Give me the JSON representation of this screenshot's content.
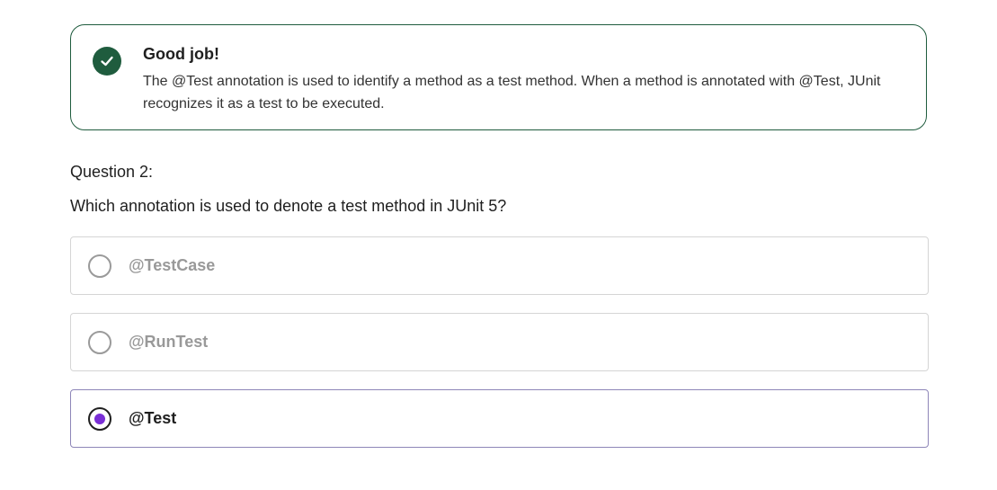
{
  "feedback": {
    "icon": "checkmark-icon",
    "status_color": "#1f5c3e",
    "title": "Good job!",
    "message": "The @Test annotation is used to identify a method as a test method. When a method is annotated with @Test, JUnit recognizes it as a test to be executed."
  },
  "question": {
    "number_label": "Question 2:",
    "text": "Which annotation is used to denote a test method in JUnit 5?",
    "accent_color": "#7a2fd6",
    "options": [
      {
        "label": "@TestCase",
        "selected": false
      },
      {
        "label": "@RunTest",
        "selected": false
      },
      {
        "label": "@Test",
        "selected": true
      }
    ]
  }
}
